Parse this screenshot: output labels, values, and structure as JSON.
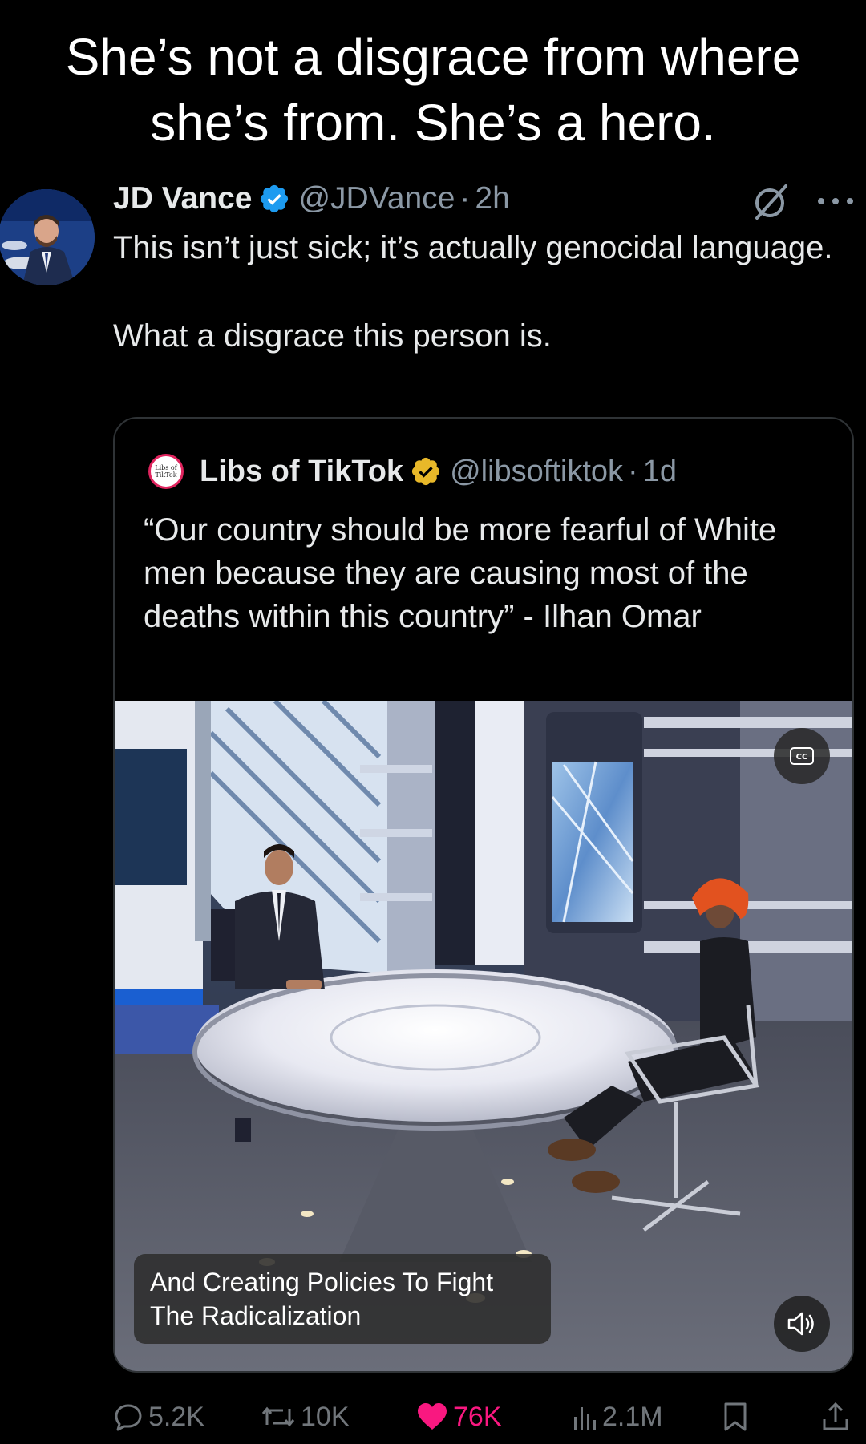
{
  "caption": {
    "line1": "She’s not a disgrace from where",
    "line2": "she’s from. She’s a hero."
  },
  "tweet": {
    "author_name": "JD Vance",
    "handle": "@JDVance",
    "separator": "·",
    "time": "2h",
    "text_line1": "This isn’t just sick; it’s actually genocidal language.",
    "text_line2": "What a disgrace this person is.",
    "icons": {
      "verified": "verified-badge-icon",
      "grok": "grok-icon",
      "more": "more-icon"
    },
    "colors": {
      "verified": "#1d9bf0",
      "like": "#f91880"
    }
  },
  "quote": {
    "author_name": "Libs of TikTok",
    "handle": "@libsoftiktok",
    "separator": "·",
    "time": "1d",
    "avatar_text": "Libs of TikTok",
    "text": "“Our country should be more fearful of White men because they are causing most of the deaths within this country” - Ilhan Omar",
    "video": {
      "cc_label": "CC",
      "subtitle_line1": "And Creating Policies To Fight",
      "subtitle_line2": "The Radicalization"
    },
    "colors": {
      "verified_gold": "#e8b829"
    }
  },
  "actions": {
    "replies": "5.2K",
    "reposts": "10K",
    "likes": "76K",
    "views": "2.1M"
  }
}
